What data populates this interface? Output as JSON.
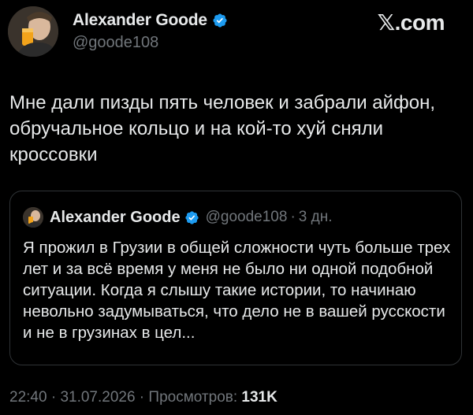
{
  "author": {
    "name": "Alexander Goode",
    "handle": "@goode108",
    "verified_icon": "verified-badge-icon",
    "verified_color": "#1d9bf0"
  },
  "brand": "𝕏.com",
  "tweet": {
    "text": "Мне дали пизды пять человек и забрали айфон, обручальное кольцо и на кой-то хуй сняли кроссовки"
  },
  "quoted_tweet": {
    "name": "Alexander Goode",
    "handle": "@goode108",
    "separator": "·",
    "time": "3 дн.",
    "text": "Я прожил в Грузии в общей сложности чуть больше трех лет и за всё время у меня не было ни одной подобной ситуации. Когда я слышу такие истории, то начинаю невольно задумываться, что дело не в вашей русскости и не в грузинах в цел..."
  },
  "meta": {
    "time": "22:40",
    "separator1": " · ",
    "date": "31.07.2026",
    "separator2": " · ",
    "views_label": "Просмотров: ",
    "views_count": "131K"
  },
  "colors": {
    "background": "#000000",
    "text": "#e7e9ea",
    "muted": "#71767b",
    "border": "#2f3336"
  }
}
